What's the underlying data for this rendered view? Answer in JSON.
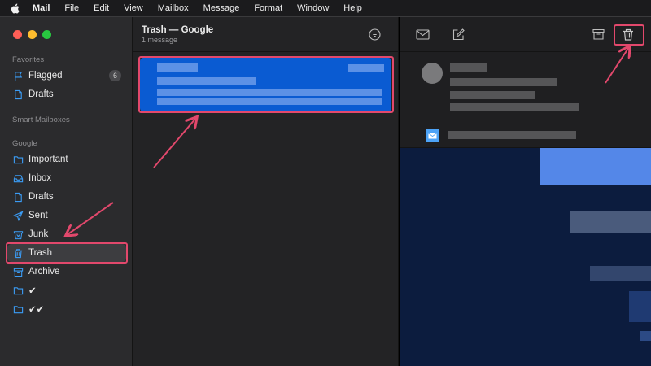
{
  "menubar": {
    "apple_icon": "apple-logo-icon",
    "items": [
      "Mail",
      "File",
      "Edit",
      "View",
      "Mailbox",
      "Message",
      "Format",
      "Window",
      "Help"
    ]
  },
  "sidebar": {
    "favorites_label": "Favorites",
    "favorites": [
      {
        "label": "Flagged",
        "icon": "flag-icon",
        "badge": "6"
      },
      {
        "label": "Drafts",
        "icon": "document-icon"
      }
    ],
    "smart_label": "Smart Mailboxes",
    "google_label": "Google",
    "google": [
      {
        "label": "Important",
        "icon": "folder-icon"
      },
      {
        "label": "Inbox",
        "icon": "inbox-icon"
      },
      {
        "label": "Drafts",
        "icon": "document-icon"
      },
      {
        "label": "Sent",
        "icon": "paperplane-icon"
      },
      {
        "label": "Junk",
        "icon": "junk-icon"
      },
      {
        "label": "Trash",
        "icon": "trash-icon",
        "selected": true
      },
      {
        "label": "Archive",
        "icon": "archive-icon"
      },
      {
        "label": "✔",
        "icon": "folder-icon"
      },
      {
        "label": "✔✔",
        "icon": "folder-icon"
      }
    ]
  },
  "message_list": {
    "title": "Trash — Google",
    "subtitle": "1 message",
    "filter_icon": "filter-icon"
  },
  "reader": {
    "toolbar": [
      "envelope-icon",
      "compose-icon",
      "archive-icon",
      "trash-icon"
    ]
  },
  "colors": {
    "accent": "#0a5bd2",
    "highlight": "#e2486c",
    "sidebar_icon": "#3b9cf5"
  }
}
